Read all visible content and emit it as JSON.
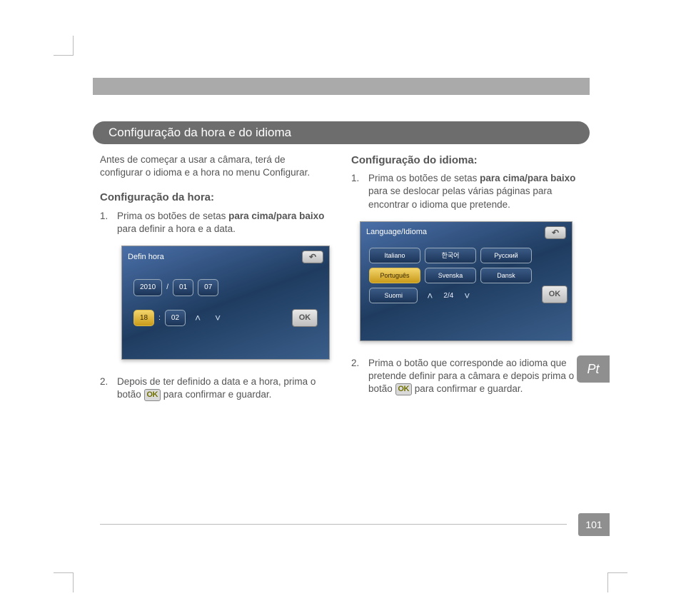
{
  "section_title": "Configuração da hora e do idioma",
  "intro": "Antes de começar a usar a câmara, terá de configurar o idioma e a hora no menu Configurar.",
  "hour": {
    "heading": "Configuração da hora:",
    "item1_prefix": "Prima os botões de setas ",
    "item1_bold": "para cima/para baixo",
    "item1_suffix": " para definir a hora e a data.",
    "item2_prefix": "Depois de ter definido a data e a hora, prima o botão ",
    "item2_suffix": " para confirmar e guardar."
  },
  "lang": {
    "heading": "Configuração do idioma:",
    "item1_prefix": "Prima os botões de setas ",
    "item1_bold": "para cima/para baixo",
    "item1_suffix": " para se deslocar pelas várias páginas para encontrar o idioma que pretende.",
    "item2_prefix": "Prima o botão que corresponde ao idioma que pretende definir para a câmara e depois prima o botão ",
    "item2_suffix": " para confirmar e guardar."
  },
  "screen_time": {
    "title": "Defin hora",
    "year": "2010",
    "month": "01",
    "day": "07",
    "hour": "18",
    "minute": "02",
    "ok": "OK"
  },
  "screen_lang": {
    "title": "Language/Idioma",
    "options": [
      "Italiano",
      "한국어",
      "Русский",
      "Português",
      "Svenska",
      "Dansk",
      "Suomi"
    ],
    "selected": "Português",
    "page": "2/4",
    "ok": "OK"
  },
  "ok_icon_text": "OK",
  "side_tab": "Pt",
  "page_number": "101"
}
